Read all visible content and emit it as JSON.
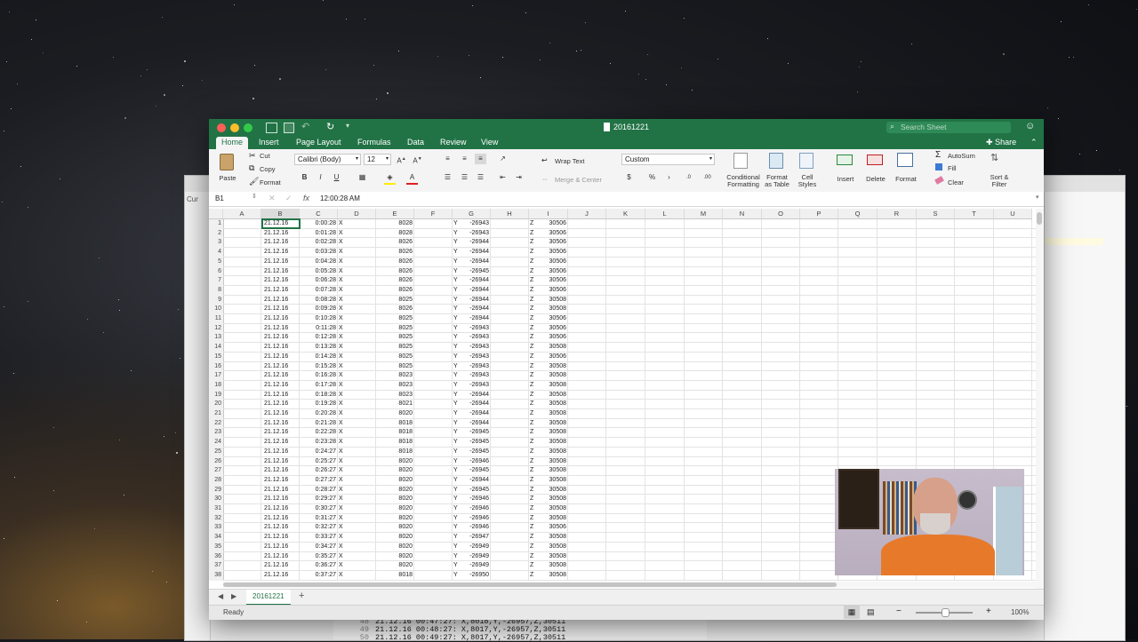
{
  "window_title": "20161221",
  "search_placeholder": "Search Sheet",
  "share_label": "Share",
  "tabs": [
    "Home",
    "Insert",
    "Page Layout",
    "Formulas",
    "Data",
    "Review",
    "View"
  ],
  "ribbon": {
    "paste": "Paste",
    "cut": "Cut",
    "copy": "Copy",
    "format_painter": "Format",
    "font_name": "Calibri (Body)",
    "font_size": "12",
    "wrap_text": "Wrap Text",
    "merge_center": "Merge & Center",
    "number_format": "Custom",
    "conditional_formatting": "Conditional\nFormatting",
    "format_as_table": "Format\nas Table",
    "cell_styles": "Cell\nStyles",
    "insert": "Insert",
    "delete": "Delete",
    "format": "Format",
    "autosum": "AutoSum",
    "fill": "Fill",
    "clear": "Clear",
    "sort_filter": "Sort &\nFilter"
  },
  "name_box": "B1",
  "formula_value": "12:00:28 AM",
  "columns": [
    "A",
    "B",
    "C",
    "D",
    "E",
    "F",
    "G",
    "H",
    "I",
    "J",
    "K",
    "L",
    "M",
    "N",
    "O",
    "P",
    "Q",
    "R",
    "S",
    "T",
    "U"
  ],
  "rows": [
    [
      "1",
      "21.12.16",
      "0:00:28",
      "X",
      "8028",
      "Y",
      "-26943",
      "Z",
      "30506"
    ],
    [
      "2",
      "21.12.16",
      "0:01:28",
      "X",
      "8028",
      "Y",
      "-26943",
      "Z",
      "30506"
    ],
    [
      "3",
      "21.12.16",
      "0:02:28",
      "X",
      "8026",
      "Y",
      "-26944",
      "Z",
      "30506"
    ],
    [
      "4",
      "21.12.16",
      "0:03:28",
      "X",
      "8026",
      "Y",
      "-26944",
      "Z",
      "30506"
    ],
    [
      "5",
      "21.12.16",
      "0:04:28",
      "X",
      "8026",
      "Y",
      "-26944",
      "Z",
      "30506"
    ],
    [
      "6",
      "21.12.16",
      "0:05:28",
      "X",
      "8026",
      "Y",
      "-26945",
      "Z",
      "30506"
    ],
    [
      "7",
      "21.12.16",
      "0:06:28",
      "X",
      "8026",
      "Y",
      "-26944",
      "Z",
      "30506"
    ],
    [
      "8",
      "21.12.16",
      "0:07:28",
      "X",
      "8026",
      "Y",
      "-26944",
      "Z",
      "30506"
    ],
    [
      "9",
      "21.12.16",
      "0:08:28",
      "X",
      "8025",
      "Y",
      "-26944",
      "Z",
      "30508"
    ],
    [
      "10",
      "21.12.16",
      "0:09:28",
      "X",
      "8026",
      "Y",
      "-26944",
      "Z",
      "30508"
    ],
    [
      "11",
      "21.12.16",
      "0:10:28",
      "X",
      "8025",
      "Y",
      "-26944",
      "Z",
      "30506"
    ],
    [
      "12",
      "21.12.16",
      "0:11:28",
      "X",
      "8025",
      "Y",
      "-26943",
      "Z",
      "30506"
    ],
    [
      "13",
      "21.12.16",
      "0:12:28",
      "X",
      "8025",
      "Y",
      "-26943",
      "Z",
      "30506"
    ],
    [
      "14",
      "21.12.16",
      "0:13:28",
      "X",
      "8025",
      "Y",
      "-26943",
      "Z",
      "30508"
    ],
    [
      "15",
      "21.12.16",
      "0:14:28",
      "X",
      "8025",
      "Y",
      "-26943",
      "Z",
      "30506"
    ],
    [
      "16",
      "21.12.16",
      "0:15:28",
      "X",
      "8025",
      "Y",
      "-26943",
      "Z",
      "30508"
    ],
    [
      "17",
      "21.12.16",
      "0:16:28",
      "X",
      "8023",
      "Y",
      "-26943",
      "Z",
      "30508"
    ],
    [
      "18",
      "21.12.16",
      "0:17:28",
      "X",
      "8023",
      "Y",
      "-26943",
      "Z",
      "30508"
    ],
    [
      "19",
      "21.12.16",
      "0:18:28",
      "X",
      "8023",
      "Y",
      "-26944",
      "Z",
      "30508"
    ],
    [
      "20",
      "21.12.16",
      "0:19:28",
      "X",
      "8021",
      "Y",
      "-26944",
      "Z",
      "30508"
    ],
    [
      "21",
      "21.12.16",
      "0:20:28",
      "X",
      "8020",
      "Y",
      "-26944",
      "Z",
      "30508"
    ],
    [
      "22",
      "21.12.16",
      "0:21:28",
      "X",
      "8018",
      "Y",
      "-26944",
      "Z",
      "30508"
    ],
    [
      "23",
      "21.12.16",
      "0:22:28",
      "X",
      "8018",
      "Y",
      "-26945",
      "Z",
      "30508"
    ],
    [
      "24",
      "21.12.16",
      "0:23:28",
      "X",
      "8018",
      "Y",
      "-26945",
      "Z",
      "30508"
    ],
    [
      "25",
      "21.12.16",
      "0:24:27",
      "X",
      "8018",
      "Y",
      "-26945",
      "Z",
      "30508"
    ],
    [
      "26",
      "21.12.16",
      "0:25:27",
      "X",
      "8020",
      "Y",
      "-26946",
      "Z",
      "30508"
    ],
    [
      "27",
      "21.12.16",
      "0:26:27",
      "X",
      "8020",
      "Y",
      "-26945",
      "Z",
      "30508"
    ],
    [
      "28",
      "21.12.16",
      "0:27:27",
      "X",
      "8020",
      "Y",
      "-26944",
      "Z",
      "30508"
    ],
    [
      "29",
      "21.12.16",
      "0:28:27",
      "X",
      "8020",
      "Y",
      "-26945",
      "Z",
      "30508"
    ],
    [
      "30",
      "21.12.16",
      "0:29:27",
      "X",
      "8020",
      "Y",
      "-26946",
      "Z",
      "30508"
    ],
    [
      "31",
      "21.12.16",
      "0:30:27",
      "X",
      "8020",
      "Y",
      "-26946",
      "Z",
      "30508"
    ],
    [
      "32",
      "21.12.16",
      "0:31:27",
      "X",
      "8020",
      "Y",
      "-26946",
      "Z",
      "30508"
    ],
    [
      "33",
      "21.12.16",
      "0:32:27",
      "X",
      "8020",
      "Y",
      "-26946",
      "Z",
      "30506"
    ],
    [
      "34",
      "21.12.16",
      "0:33:27",
      "X",
      "8020",
      "Y",
      "-26947",
      "Z",
      "30508"
    ],
    [
      "35",
      "21.12.16",
      "0:34:27",
      "X",
      "8020",
      "Y",
      "-26949",
      "Z",
      "30508"
    ],
    [
      "36",
      "21.12.16",
      "0:35:27",
      "X",
      "8020",
      "Y",
      "-26949",
      "Z",
      "30508"
    ],
    [
      "37",
      "21.12.16",
      "0:36:27",
      "X",
      "8020",
      "Y",
      "-26949",
      "Z",
      "30508"
    ],
    [
      "38",
      "21.12.16",
      "0:37:27",
      "X",
      "8018",
      "Y",
      "-26950",
      "Z",
      "30508"
    ]
  ],
  "sheet_tab": "20161221",
  "status_text": "Ready",
  "zoom": "100%",
  "bg_terminal": [
    {
      "ln": "48",
      "tx": "21.12.16 00:47:27: X,8018,Y,-26957,Z,30511"
    },
    {
      "ln": "49",
      "tx": "21.12.16 00:48:27: X,8017,Y,-26957,Z,30511"
    },
    {
      "ln": "50",
      "tx": "21.12.16 00:49:27: X,8017,Y,-26957,Z,30511"
    }
  ],
  "bg_window_label": "Cur",
  "colors": {
    "excel_green": "#217346",
    "selection": "#217346"
  }
}
